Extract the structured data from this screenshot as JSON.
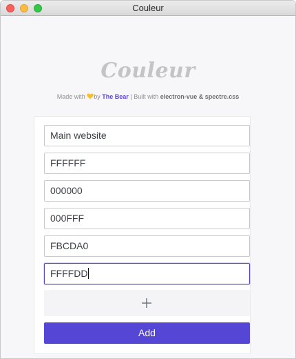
{
  "window": {
    "title": "Couleur"
  },
  "header": {
    "logo_text": "Couleur",
    "credits": {
      "made_with": "Made with",
      "by": "by",
      "author": "The Bear",
      "separator": "|",
      "built_with": "Built with",
      "tech": "electron-vue & spectre.css"
    }
  },
  "form": {
    "fields": [
      {
        "value": "Main website",
        "focused": false
      },
      {
        "value": "FFFFFF",
        "focused": false
      },
      {
        "value": "000000",
        "focused": false
      },
      {
        "value": "000FFF",
        "focused": false
      },
      {
        "value": "FBCDA0",
        "focused": false
      },
      {
        "value": "FFFFDD",
        "focused": true
      }
    ],
    "add_color_icon": "plus-icon",
    "submit_label": "Add"
  },
  "colors": {
    "accent": "#5646d6",
    "heart": "#f5c02a"
  }
}
